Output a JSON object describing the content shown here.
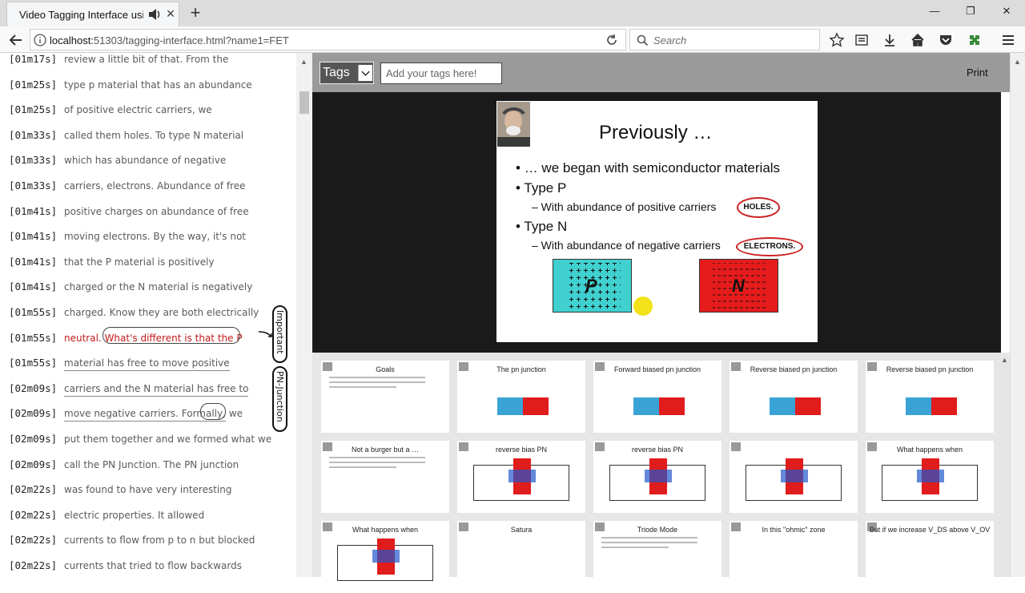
{
  "browser": {
    "tab_title": "Video Tagging Interface using",
    "url_prefix": "localhost:",
    "url_rest": "51303/tagging-interface.html?name1=FET",
    "search_placeholder": "Search",
    "new_tab": "+",
    "close_tab": "×",
    "window_controls": [
      "—",
      "❐",
      "✕"
    ]
  },
  "transcript": {
    "rows": [
      {
        "time": "[01m17s]",
        "text": "review a little bit of that. From the"
      },
      {
        "time": "[01m25s]",
        "text": "type p material that has an abundance"
      },
      {
        "time": "[01m25s]",
        "text": "of positive electric carriers, we"
      },
      {
        "time": "[01m33s]",
        "text": "called them holes. To type N material"
      },
      {
        "time": "[01m33s]",
        "text": "which has abundance of negative"
      },
      {
        "time": "[01m33s]",
        "text": "carriers, electrons. Abundance of free"
      },
      {
        "time": "[01m41s]",
        "text": "positive charges on abundance of free"
      },
      {
        "time": "[01m41s]",
        "text": "moving electrons. By the way, it's not"
      },
      {
        "time": "[01m41s]",
        "text": "that the P material is positively"
      },
      {
        "time": "[01m41s]",
        "text": "charged or the N material is negatively"
      },
      {
        "time": "[01m55s]",
        "text": "charged. Know they are both electrically"
      },
      {
        "time": "[01m55s]",
        "pre": "neutral. ",
        "text": "What's different is that the P"
      },
      {
        "time": "[01m55s]",
        "text": "material has free to move positive"
      },
      {
        "time": "[02m09s]",
        "text": "carriers and the N material has free to"
      },
      {
        "time": "[02m09s]",
        "text": "move negative carriers. Formally,",
        "post": " we"
      },
      {
        "time": "[02m09s]",
        "text": "put them together and we formed what we"
      },
      {
        "time": "[02m09s]",
        "text": "call the PN Junction. The PN junction"
      },
      {
        "time": "[02m22s]",
        "text": "was found to have very interesting"
      },
      {
        "time": "[02m22s]",
        "text": "electric properties. It allowed"
      },
      {
        "time": "[02m22s]",
        "text": "currents to flow from p to n but blocked"
      },
      {
        "time": "[02m22s]",
        "text": "currents that tried to flow backwards"
      }
    ],
    "tags": [
      "Important",
      "PN-Junction"
    ]
  },
  "toolbar": {
    "tags_label": "Tags",
    "tags_placeholder": "Add your tags here!",
    "print_label": "Print"
  },
  "slide": {
    "title": "Previously …",
    "bullets": [
      "… we began with semiconductor materials",
      "Type P",
      "Type N"
    ],
    "sub1": "– With abundance of positive carriers",
    "sub2": "– With abundance of negative carriers",
    "oval1": "HOLES.",
    "oval2": "ELECTRONS.",
    "p_label": "P",
    "n_label": "N"
  },
  "thumbnails": [
    {
      "title": "Goals"
    },
    {
      "title": "The pn junction"
    },
    {
      "title": "Forward biased pn junction"
    },
    {
      "title": "Reverse biased pn junction"
    },
    {
      "title": "Reverse biased pn junction"
    },
    {
      "title": "Not a burger but a …"
    },
    {
      "title": "reverse bias PN"
    },
    {
      "title": "reverse bias PN"
    },
    {
      "title": ""
    },
    {
      "title": "What happens when"
    },
    {
      "title": "What happens when"
    },
    {
      "title": "Satura"
    },
    {
      "title": "Triode Mode"
    },
    {
      "title": "In this \"ohmic\" zone"
    },
    {
      "title": "But if we increase V_DS above V_OV"
    }
  ],
  "colors": {
    "p_material": "#40d0cf",
    "n_material": "#e61c1c",
    "highlight_text": "#c41a1a"
  }
}
